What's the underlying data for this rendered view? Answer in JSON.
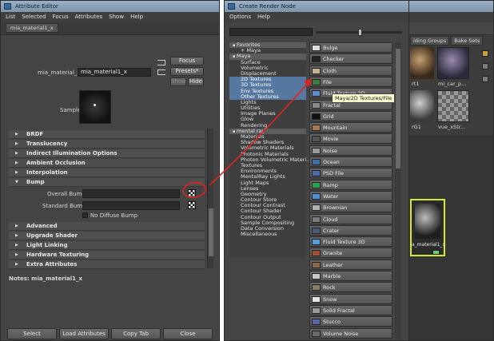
{
  "attr_editor": {
    "title": "Attribute Editor",
    "menu": [
      "List",
      "Selected",
      "Focus",
      "Attributes",
      "Show",
      "Help"
    ],
    "tab": "mia_material1_x",
    "node_label": "mia_material_x:",
    "node_value": "mia_material1_x",
    "focus": "Focus",
    "presets": "Presets*",
    "show": "Show",
    "hide": "Hide",
    "sample_label": "Sample",
    "sections": [
      {
        "label": "BRDF",
        "open": false
      },
      {
        "label": "Translucency",
        "open": false
      },
      {
        "label": "Indirect Illumination Options",
        "open": false
      },
      {
        "label": "Ambient Occlusion",
        "open": false
      },
      {
        "label": "Interpolation",
        "open": false
      },
      {
        "label": "Bump",
        "open": true
      }
    ],
    "overall_bump": "Overall Bump",
    "standard_bump": "Standard Bump",
    "no_diffuse_bump": "No Diffuse Bump",
    "sections2": [
      {
        "label": "Advanced"
      },
      {
        "label": "Upgrade Shader"
      },
      {
        "label": "Light Linking"
      },
      {
        "label": "Hardware Texturing"
      },
      {
        "label": "Extra Attributes"
      }
    ],
    "notes": "Notes:  mia_material1_x",
    "bottom_buttons": [
      "Select",
      "Load Attributes",
      "Copy Tab",
      "Close"
    ]
  },
  "render_node": {
    "title": "Create Render Node",
    "menu": [
      "Options",
      "Help"
    ],
    "categories": [
      {
        "label": "Favorites",
        "type": "hdr"
      },
      {
        "label": "+ Maya",
        "type": "plain"
      },
      {
        "label": "Maya",
        "type": "hdr"
      },
      {
        "label": "Surface",
        "type": "plain"
      },
      {
        "label": "Volumetric",
        "type": "plain"
      },
      {
        "label": "Displacement",
        "type": "plain"
      },
      {
        "label": "2D Textures",
        "type": "sel"
      },
      {
        "label": "3D Textures",
        "type": "sel"
      },
      {
        "label": "Env Textures",
        "type": "sel"
      },
      {
        "label": "Other Textures",
        "type": "sel"
      },
      {
        "label": "Lights",
        "type": "plain"
      },
      {
        "label": "Utilities",
        "type": "plain"
      },
      {
        "label": "Image Planes",
        "type": "plain"
      },
      {
        "label": "Glow",
        "type": "plain"
      },
      {
        "label": "Rendering",
        "type": "plain"
      },
      {
        "label": "mental ray",
        "type": "hdr"
      },
      {
        "label": "Materials",
        "type": "plain"
      },
      {
        "label": "Shadow Shaders",
        "type": "plain"
      },
      {
        "label": "Volumetric Materials",
        "type": "plain"
      },
      {
        "label": "Photonic Materials",
        "type": "plain"
      },
      {
        "label": "Photon Volumetric Materi...",
        "type": "plain"
      },
      {
        "label": "Textures",
        "type": "plain"
      },
      {
        "label": "Environments",
        "type": "plain"
      },
      {
        "label": "MentalRay Lights",
        "type": "plain"
      },
      {
        "label": "Light Maps",
        "type": "plain"
      },
      {
        "label": "Lenses",
        "type": "plain"
      },
      {
        "label": "Geometry",
        "type": "plain"
      },
      {
        "label": "Contour Store",
        "type": "plain"
      },
      {
        "label": "Contour Contrast",
        "type": "plain"
      },
      {
        "label": "Contour Shader",
        "type": "plain"
      },
      {
        "label": "Contour Output",
        "type": "plain"
      },
      {
        "label": "Sample Compositing",
        "type": "plain"
      },
      {
        "label": "Data Conversion",
        "type": "plain"
      },
      {
        "label": "Miscellaneous",
        "type": "plain"
      }
    ],
    "nodes": [
      {
        "label": "Bulge",
        "color": "#dcdcdc"
      },
      {
        "label": "Checker",
        "color": "#222222"
      },
      {
        "label": "Cloth",
        "color": "#c8b48a"
      },
      {
        "label": "File",
        "color": "#3d7d3d"
      },
      {
        "label": "Fluid Texture 2D",
        "color": "#5f8fd0"
      },
      {
        "label": "Fractal",
        "color": "#8a8a8a"
      },
      {
        "label": "Grid",
        "color": "#111111"
      },
      {
        "label": "Mountain",
        "color": "#a07a50"
      },
      {
        "label": "Movie",
        "color": "#555555"
      },
      {
        "label": "Noise",
        "color": "#9a9a9a"
      },
      {
        "label": "Ocean",
        "color": "#3f6fa8"
      },
      {
        "label": "PSD File",
        "color": "#4a6ab0"
      },
      {
        "label": "Ramp",
        "color": "#2aa050"
      },
      {
        "label": "Water",
        "color": "#4a8fd8"
      },
      {
        "label": "Brownian",
        "color": "#b0b0b0"
      },
      {
        "label": "Cloud",
        "color": "#7a7a7a"
      },
      {
        "label": "Crater",
        "color": "#4a5a7a"
      },
      {
        "label": "Fluid Texture 3D",
        "color": "#5a9ad8"
      },
      {
        "label": "Granite",
        "color": "#a0503a"
      },
      {
        "label": "Leather",
        "color": "#8a6a4a"
      },
      {
        "label": "Marble",
        "color": "#c8c8c8"
      },
      {
        "label": "Rock",
        "color": "#8a7a6a"
      },
      {
        "label": "Snow",
        "color": "#e6e6e6"
      },
      {
        "label": "Solid Fractal",
        "color": "#9a9a9a"
      },
      {
        "label": "Stucco",
        "color": "#5a6aa8"
      },
      {
        "label": "Volume Noise",
        "color": "#6a6a6a"
      }
    ],
    "tooltip": "Maya/2D Textures/File"
  },
  "hypershade": {
    "tabs": [
      "iding Groups",
      "Bake Sets"
    ],
    "swatch_labels": [
      "rt1",
      "mi_car_p...",
      "rG1",
      "vue_xStr..."
    ],
    "selected_label": "a_material1_x"
  },
  "colors": {
    "accent": "#e0231f",
    "highlight": "#5678a0",
    "selected_swatch": "#d6e82a"
  }
}
